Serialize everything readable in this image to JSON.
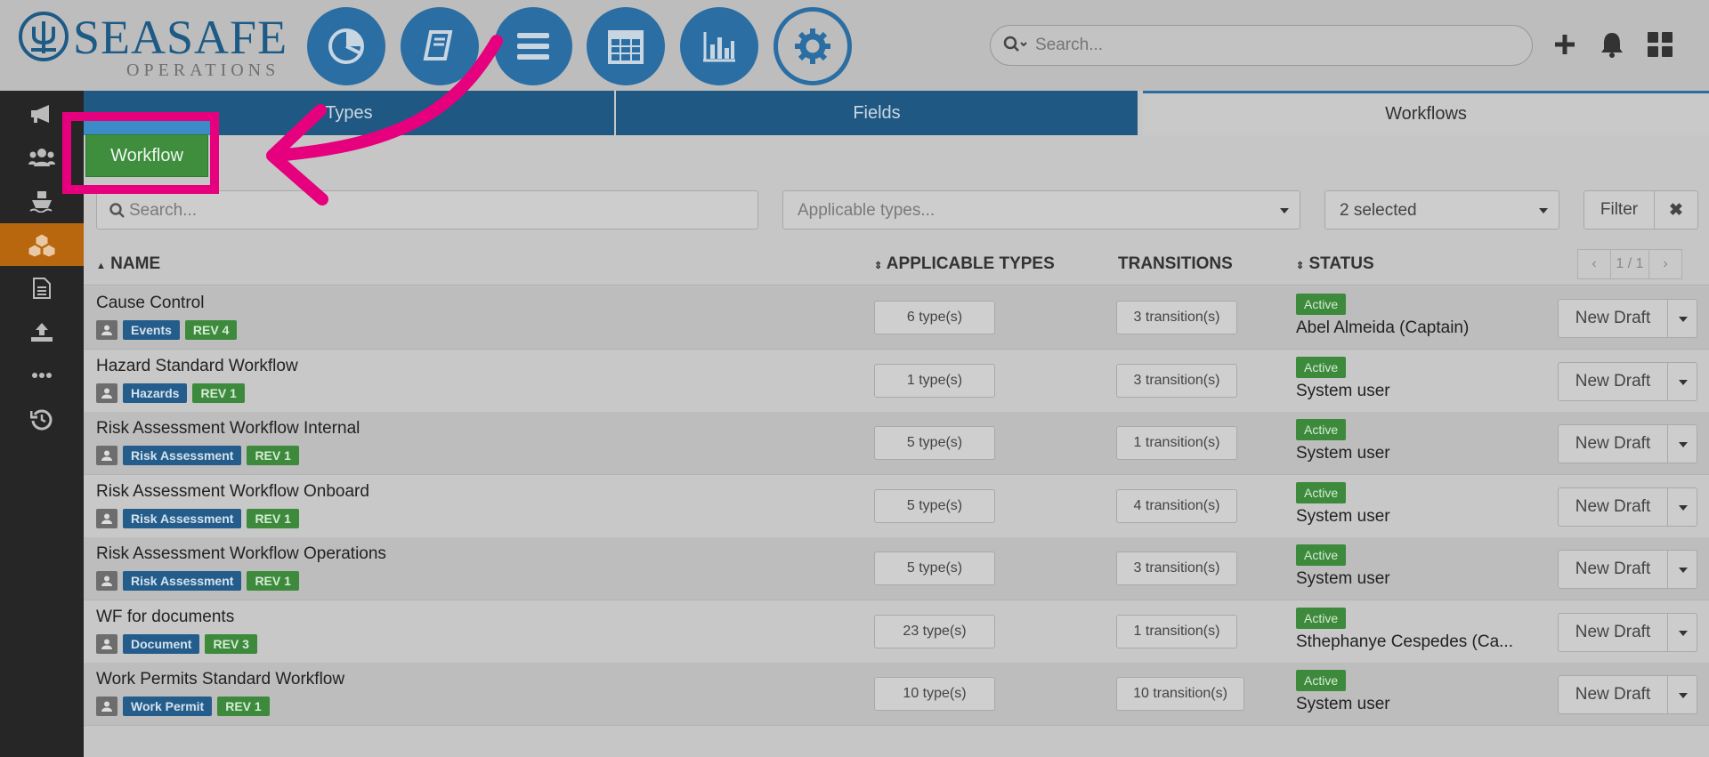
{
  "logo": {
    "brand": "SEASAFE",
    "sub": "OPERATIONS"
  },
  "topnav": {
    "items": [
      {
        "name": "dashboard-nav-button",
        "icon": "pie-chart-icon"
      },
      {
        "name": "manual-nav-button",
        "icon": "book-icon"
      },
      {
        "name": "menu-nav-button",
        "icon": "hamburger-icon"
      },
      {
        "name": "calendar-nav-button",
        "icon": "calendar-icon"
      },
      {
        "name": "reports-nav-button",
        "icon": "bar-chart-icon"
      },
      {
        "name": "settings-nav-button",
        "icon": "gear-icon"
      }
    ],
    "search_placeholder": "Search..."
  },
  "sidebar": {
    "items": [
      {
        "icon": "megaphone-icon"
      },
      {
        "icon": "users-icon"
      },
      {
        "icon": "ship-icon"
      },
      {
        "icon": "cubes-icon",
        "active": true
      },
      {
        "icon": "document-icon"
      },
      {
        "icon": "upload-icon"
      },
      {
        "icon": "more-icon"
      },
      {
        "icon": "history-icon"
      }
    ]
  },
  "tabs": [
    {
      "label": "Types"
    },
    {
      "label": "Fields"
    },
    {
      "label": "Workflows",
      "active": true
    }
  ],
  "actions": {
    "workflow_label": "Workflow"
  },
  "filters": {
    "search_placeholder": "Search...",
    "types_placeholder": "Applicable types...",
    "status_value": "2 selected",
    "filter_label": "Filter",
    "clear_label": "✖"
  },
  "table": {
    "headers": {
      "name": "NAME",
      "types": "APPLICABLE TYPES",
      "transitions": "TRANSITIONS",
      "status": "STATUS"
    },
    "pager": {
      "prev": "‹",
      "page": "1 / 1",
      "next": "›"
    },
    "rows": [
      {
        "name": "Cause Control",
        "type": "Events",
        "rev": "REV 4",
        "types": "6 type(s)",
        "transitions": "3 transition(s)",
        "status": "Active",
        "user": "Abel Almeida (Captain)",
        "action": "New Draft"
      },
      {
        "name": "Hazard Standard Workflow",
        "type": "Hazards",
        "rev": "REV 1",
        "types": "1 type(s)",
        "transitions": "3 transition(s)",
        "status": "Active",
        "user": "System user",
        "action": "New Draft"
      },
      {
        "name": "Risk Assessment Workflow Internal",
        "type": "Risk Assessment",
        "rev": "REV 1",
        "types": "5 type(s)",
        "transitions": "1 transition(s)",
        "status": "Active",
        "user": "System user",
        "action": "New Draft"
      },
      {
        "name": "Risk Assessment Workflow Onboard",
        "type": "Risk Assessment",
        "rev": "REV 1",
        "types": "5 type(s)",
        "transitions": "4 transition(s)",
        "status": "Active",
        "user": "System user",
        "action": "New Draft"
      },
      {
        "name": "Risk Assessment Workflow Operations",
        "type": "Risk Assessment",
        "rev": "REV 1",
        "types": "5 type(s)",
        "transitions": "3 transition(s)",
        "status": "Active",
        "user": "System user",
        "action": "New Draft"
      },
      {
        "name": "WF for documents",
        "type": "Document",
        "rev": "REV 3",
        "types": "23 type(s)",
        "transitions": "1 transition(s)",
        "status": "Active",
        "user": "Sthephanye Cespedes (Ca...",
        "action": "New Draft"
      },
      {
        "name": "Work Permits Standard Workflow",
        "type": "Work Permit",
        "rev": "REV 1",
        "types": "10 type(s)",
        "transitions": "10 transition(s)",
        "status": "Active",
        "user": "System user",
        "action": "New Draft"
      }
    ]
  },
  "colors": {
    "accent": "#2b6ea3",
    "highlight": "#e6007e",
    "success": "#3d8a3d",
    "sidebar_active": "#b8670f"
  }
}
